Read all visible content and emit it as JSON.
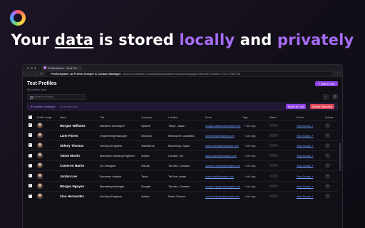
{
  "headline": {
    "part1": "Your ",
    "part2": "data",
    "part3": " is stored ",
    "part4": "locally",
    "part5": " and ",
    "part6": "privately"
  },
  "browser": {
    "tab_title": "ProfileSpider - Test Pro",
    "url_title": "ProfileSpider: AI Profile Scraper & Contact Manager",
    "url_text": "chrome-extension://cnlnkbjofmidnkbanmmdonlepnodapgl/profiles.html?listId=1731177060728"
  },
  "app": {
    "title": "Test Profiles",
    "subtitle": "89 profiles total",
    "add_list_label": "+ Add to List",
    "search_placeholder": "Search profiles...",
    "selection_text": "89 profiles selected",
    "clear_selection": "Clear selection",
    "move_label": "Move to List",
    "delete_label": "Delete Selected"
  },
  "table": {
    "headers": [
      "",
      "Profile Image",
      "Name",
      "Title",
      "Company",
      "Location",
      "Email",
      "Tags",
      "Status",
      "Source",
      "Actions"
    ],
    "rows": [
      {
        "name": "Morgan Williams",
        "title": "Backend Developer",
        "company": "Spacell",
        "location": "Tokyo, Japan",
        "email": "morgan.williams@example.com",
        "tags": "+ Add tags",
        "source": "View Source ↗"
      },
      {
        "name": "Lane Flores",
        "title": "Engineering Manager",
        "company": "Dropbox",
        "location": "Melbourne, Australia",
        "email": "lane.flores@example.com",
        "tags": "+ Add tags",
        "source": "View Source ↗"
      },
      {
        "name": "Sidney Thomas",
        "title": "DevOps Engineer",
        "company": "Salesforce",
        "location": "Barcelona, Spain",
        "email": "sidney.thomas@example.com",
        "tags": "+ Add tags",
        "source": "View Source ↗"
      },
      {
        "name": "Tatum Martin",
        "title": "Machine Learning Engineer",
        "company": "Adobe",
        "location": "London, UK",
        "email": "tatum.martin@example.com",
        "tags": "+ Add tags",
        "source": "View Source ↗"
      },
      {
        "name": "Cameron Martin",
        "title": "UX Designer",
        "company": "GitLab",
        "location": "Toronto, Canada",
        "email": "cameron.martin@example.com",
        "tags": "+ Add tags",
        "source": "View Source ↗"
      },
      {
        "name": "Jordan Lee",
        "title": "Business Analyst",
        "company": "Tesla",
        "location": "Tel Aviv, Israel",
        "email": "jordan.lee@example.com",
        "tags": "+ Add tags",
        "source": "View Source ↗"
      },
      {
        "name": "Morgan Nguyen",
        "title": "Marketing Manager",
        "company": "Google",
        "location": "Toronto, Canada",
        "email": "morgan.nguyen@example.com",
        "tags": "+ Add tags",
        "source": "View Source ↗"
      },
      {
        "name": "Zion Hernandez",
        "title": "DevOps Engineer",
        "company": "Adobe",
        "location": "Paris, France",
        "email": "zion.hernandez@example.com",
        "tags": "+ Add tags",
        "source": "View Source ↗"
      }
    ]
  }
}
